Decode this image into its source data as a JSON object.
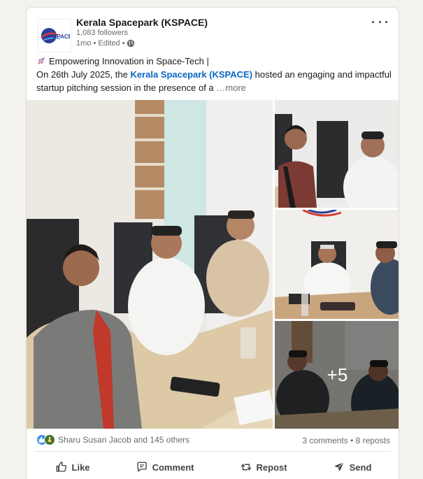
{
  "post": {
    "author": {
      "name": "Kerala Spacepark (KSPACE)",
      "followers": "1,083 followers",
      "meta": "1mo • Edited •",
      "logo_text": "SPACE"
    },
    "commentary": {
      "line1": "Empowering Innovation in Space-Tech |",
      "line2_prefix": "On 26th July 2025, the",
      "line2_mention": "Kerala Spacepark (KSPACE)",
      "line2_suffix": "hosted an engaging and impactful",
      "line3": "startup pitching session in the presence of a",
      "see_more": "…more"
    },
    "images": {
      "more_count": "+5"
    },
    "social": {
      "reaction_names": "Sharu Susan Jacob and 145 others",
      "counts": "3 comments • 8 reposts"
    },
    "actions": {
      "like": "Like",
      "comment": "Comment",
      "repost": "Repost",
      "send": "Send"
    }
  },
  "colors": {
    "link": "#0a66c2",
    "like_reaction": "#378fe9",
    "celebrate_reaction": "#44712e"
  }
}
